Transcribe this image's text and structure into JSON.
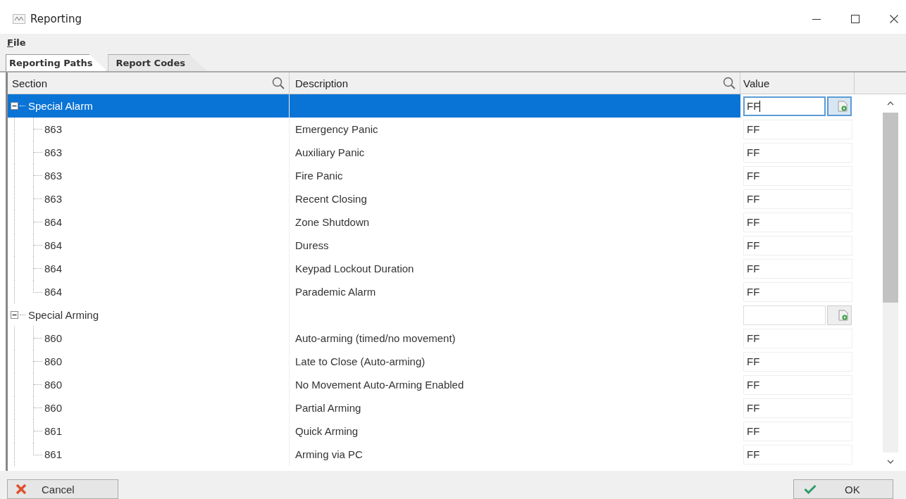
{
  "window": {
    "title": "Reporting"
  },
  "menu": [
    {
      "label": "File"
    }
  ],
  "tabs": [
    {
      "label": "Reporting Paths",
      "selected": true
    },
    {
      "label": "Report Codes",
      "selected": false
    }
  ],
  "columns": [
    "Section",
    "Description",
    "Value"
  ],
  "groups": [
    {
      "section": "Special Alarm",
      "expanded": true,
      "selected": true,
      "value": "FF",
      "editing": true,
      "children": [
        {
          "section": "863",
          "description": "Emergency Panic",
          "value": "FF"
        },
        {
          "section": "863",
          "description": "Auxiliary Panic",
          "value": "FF"
        },
        {
          "section": "863",
          "description": "Fire Panic",
          "value": "FF"
        },
        {
          "section": "863",
          "description": "Recent Closing",
          "value": "FF"
        },
        {
          "section": "864",
          "description": "Zone Shutdown",
          "value": "FF"
        },
        {
          "section": "864",
          "description": "Duress",
          "value": "FF"
        },
        {
          "section": "864",
          "description": "Keypad Lockout Duration",
          "value": "FF"
        },
        {
          "section": "864",
          "description": "Parademic Alarm",
          "value": "FF"
        }
      ]
    },
    {
      "section": "Special Arming",
      "expanded": true,
      "selected": false,
      "editing": false,
      "children": [
        {
          "section": "860",
          "description": "Auto-arming (timed/no movement)",
          "value": "FF"
        },
        {
          "section": "860",
          "description": "Late to Close (Auto-arming)",
          "value": "FF"
        },
        {
          "section": "860",
          "description": "No Movement Auto-Arming Enabled",
          "value": "FF"
        },
        {
          "section": "860",
          "description": "Partial Arming",
          "value": "FF"
        },
        {
          "section": "861",
          "description": "Quick Arming",
          "value": "FF"
        },
        {
          "section": "861",
          "description": "Arming via PC",
          "value": "FF"
        }
      ]
    }
  ],
  "buttons": {
    "cancel": "Cancel",
    "ok": "OK"
  }
}
